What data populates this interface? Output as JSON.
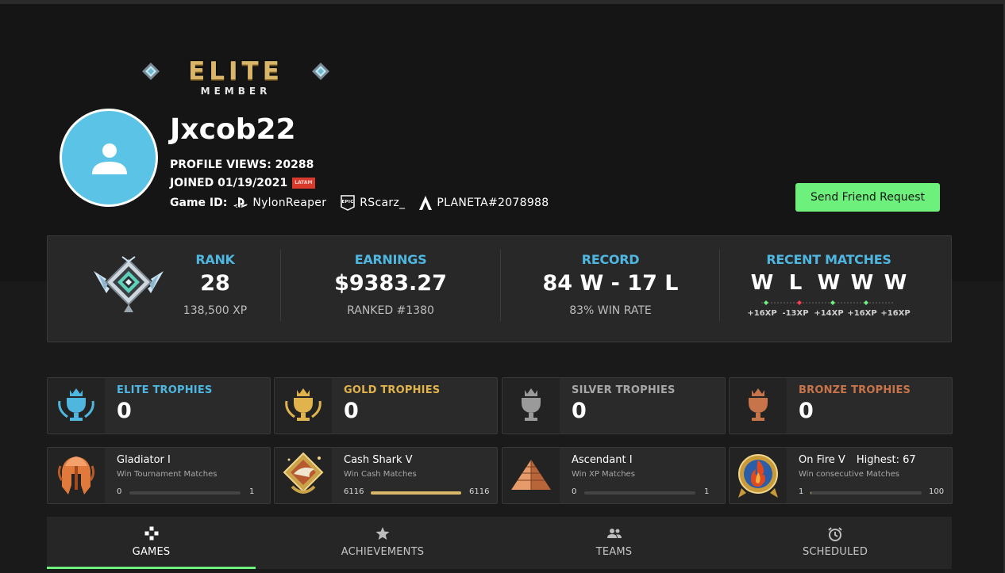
{
  "badge": {
    "word": "ELITE",
    "sub": "MEMBER"
  },
  "profile": {
    "username": "Jxcob22",
    "profile_views": "PROFILE VIEWS: 20288",
    "joined": "JOINED 01/19/2021",
    "region_tag": "LATAM",
    "game_id_label": "Game ID:",
    "game_ids": [
      {
        "platform": "playstation-icon",
        "name": "NylonReaper"
      },
      {
        "platform": "epic-games-icon",
        "name": "RScarz_"
      },
      {
        "platform": "activision-icon",
        "name": "PLANETA#2078988"
      }
    ],
    "friend_button": "Send Friend Request"
  },
  "stats": {
    "rank": {
      "label": "RANK",
      "value": "28",
      "sub": "138,500 XP"
    },
    "earnings": {
      "label": "EARNINGS",
      "value": "$9383.27",
      "sub": "RANKED #1380"
    },
    "record": {
      "label": "RECORD",
      "value": "84 W - 17 L",
      "sub": "83% WIN RATE"
    },
    "recent": {
      "label": "RECENT MATCHES",
      "results": [
        "W",
        "L",
        "W",
        "W",
        "W"
      ],
      "xp": [
        "+16XP",
        "-13XP",
        "+14XP",
        "+16XP",
        "+16XP"
      ]
    }
  },
  "trophies": [
    {
      "label": "ELITE TROPHIES",
      "value": "0",
      "color": "#4fb6e0"
    },
    {
      "label": "GOLD TROPHIES",
      "value": "0",
      "color": "#e0b34c"
    },
    {
      "label": "SILVER TROPHIES",
      "value": "0",
      "color": "#a7a7a7"
    },
    {
      "label": "BRONZE TROPHIES",
      "value": "0",
      "color": "#c8744a"
    }
  ],
  "achievements": [
    {
      "name": "Gladiator I",
      "desc": "Win Tournament Matches",
      "min": "0",
      "max": "1",
      "progress": 0
    },
    {
      "name": "Cash Shark V",
      "desc": "Win Cash Matches",
      "min": "6116",
      "max": "6116",
      "progress": 1
    },
    {
      "name": "Ascendant I",
      "desc": "Win XP Matches",
      "min": "0",
      "max": "1",
      "progress": 0
    },
    {
      "name": "On Fire V",
      "highest": "Highest: 67",
      "desc": "Win consecutive Matches",
      "min": "1",
      "max": "100",
      "progress": 0.01
    }
  ],
  "tabs": [
    {
      "label": "GAMES",
      "icon": "gamepad-icon",
      "active": true
    },
    {
      "label": "ACHIEVEMENTS",
      "icon": "star-icon",
      "active": false
    },
    {
      "label": "TEAMS",
      "icon": "team-icon",
      "active": false
    },
    {
      "label": "SCHEDULED",
      "icon": "alarm-clock-icon",
      "active": false
    }
  ],
  "colors": {
    "accent_green": "#6ef07c",
    "accent_blue": "#4fb6e0",
    "win": "#6ef07c",
    "loss": "#ff3b4f"
  }
}
